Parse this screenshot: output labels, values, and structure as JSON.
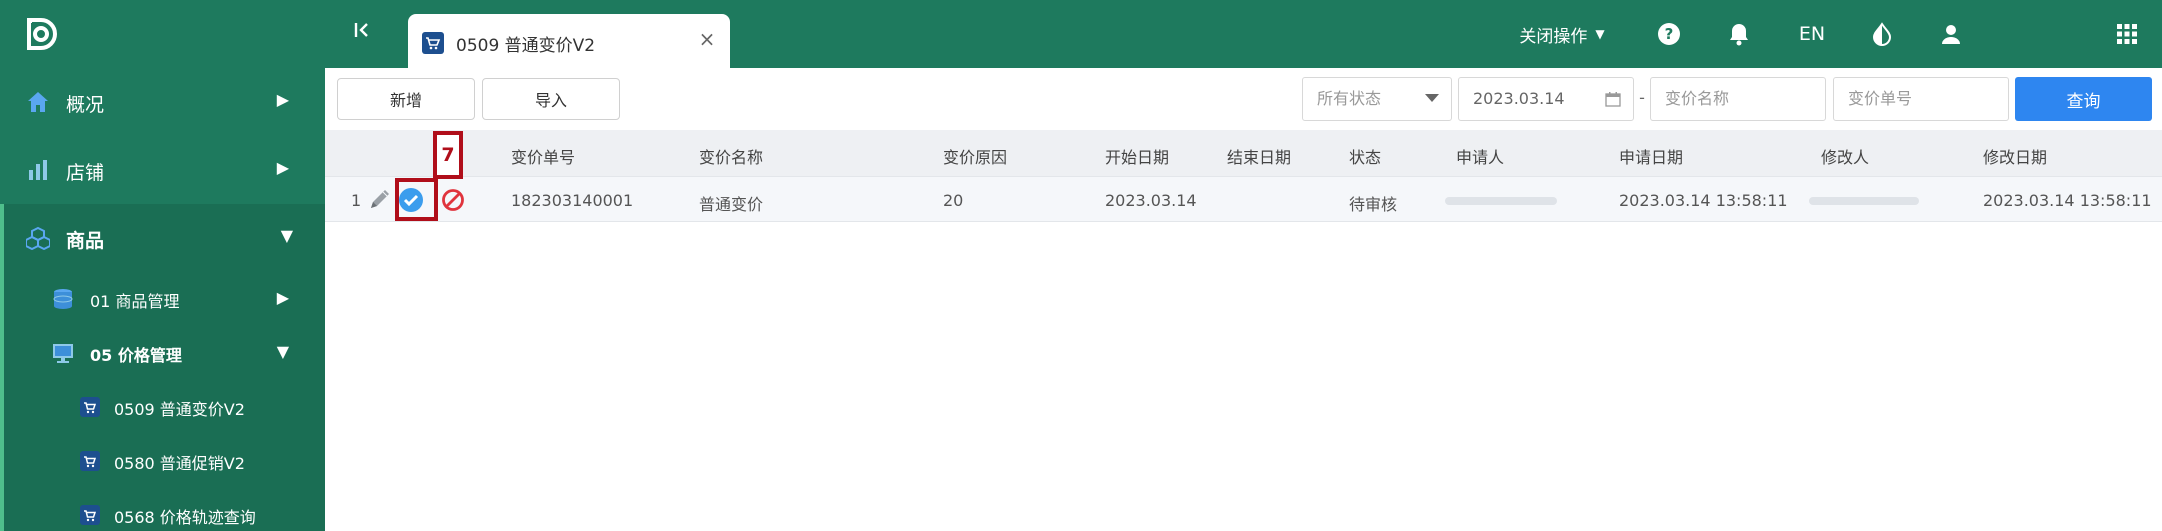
{
  "header": {
    "close_ops_label": "关闭操作",
    "lang_label": "EN",
    "active_tab": {
      "label": "0509 普通变价V2",
      "icon": "cart-icon"
    }
  },
  "sidebar": {
    "items": [
      {
        "label": "概况",
        "icon": "home-icon",
        "expanded": false
      },
      {
        "label": "店铺",
        "icon": "chart-icon",
        "expanded": false
      },
      {
        "label": "商品",
        "icon": "cubes-icon",
        "expanded": true,
        "children": [
          {
            "label": "01 商品管理",
            "icon": "database-icon",
            "expanded": false
          },
          {
            "label": "05 价格管理",
            "icon": "monitor-icon",
            "expanded": true,
            "children": [
              {
                "label": "0509 普通变价V2",
                "icon": "cart-icon"
              },
              {
                "label": "0580 普通促销V2",
                "icon": "cart-icon"
              },
              {
                "label": "0568 价格轨迹查询",
                "icon": "cart-icon"
              }
            ]
          }
        ]
      }
    ]
  },
  "toolbar": {
    "add_label": "新增",
    "import_label": "导入",
    "status_value": "所有状态",
    "date_value": "2023.03.14",
    "range_separator": "-",
    "name_placeholder": "变价名称",
    "no_placeholder": "变价单号",
    "query_label": "查询"
  },
  "table": {
    "columns": [
      "变价单号",
      "变价名称",
      "变价原因",
      "开始日期",
      "结束日期",
      "状态",
      "申请人",
      "申请日期",
      "修改人",
      "修改日期"
    ],
    "rows": [
      {
        "index": "1",
        "order_no": "182303140001",
        "name": "普通变价",
        "reason": "20",
        "start_date": "2023.03.14",
        "end_date": "",
        "status": "待审核",
        "applicant": "",
        "apply_date": "2023.03.14 13:58:11",
        "modifier": "",
        "modify_date": "2023.03.14 13:58:11"
      }
    ]
  },
  "annotation": {
    "label": "7"
  },
  "colors": {
    "brand_green": "#1e7a5e",
    "primary_blue": "#2e86f0",
    "marker_red": "#b00e1a"
  }
}
